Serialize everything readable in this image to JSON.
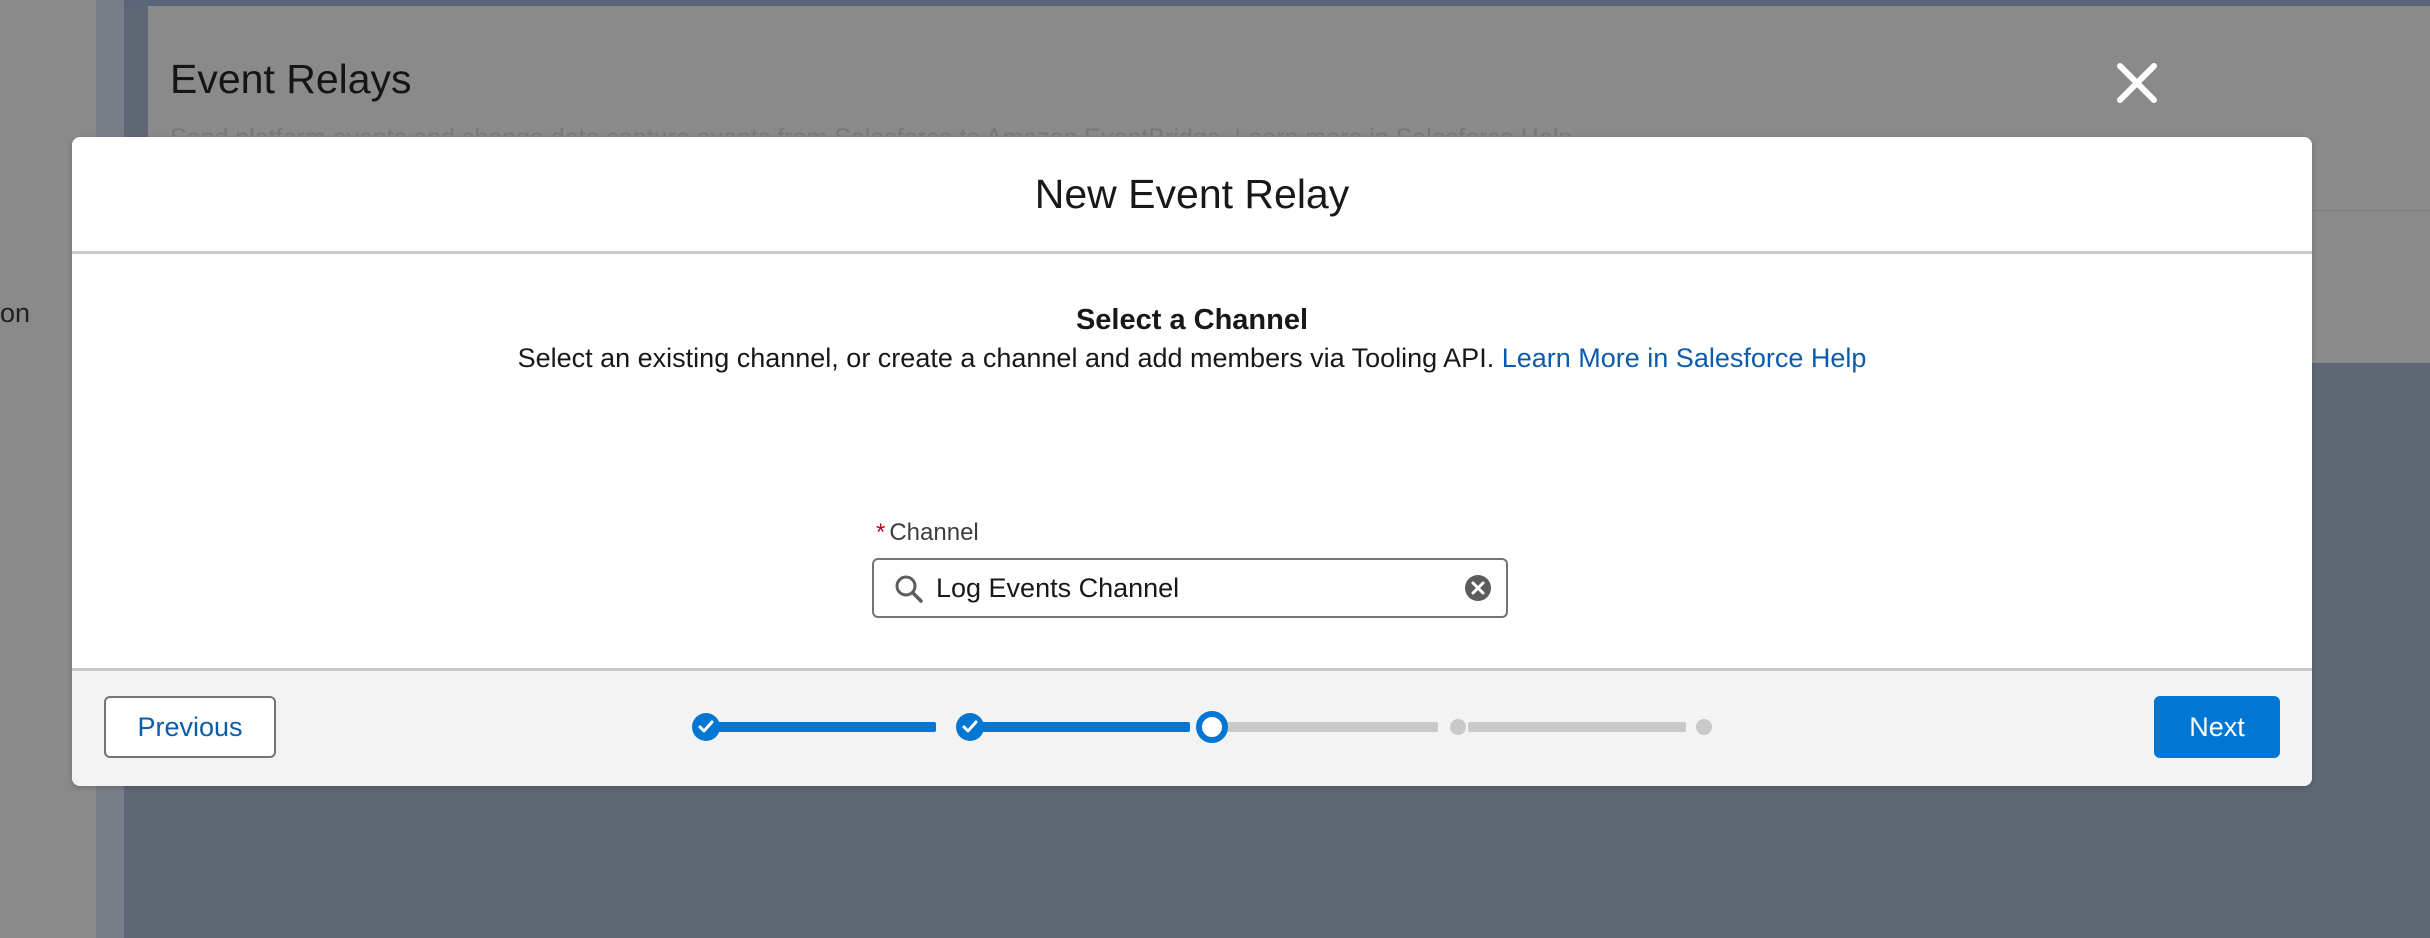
{
  "background": {
    "left_panel_text": "on",
    "page_title": "Event Relays",
    "page_subtitle": "Send platform events and change data capture events from Salesforce to Amazon EventBridge. Learn more in Salesforce Help."
  },
  "modal": {
    "title": "New Event Relay",
    "section_title": "Select a Channel",
    "description": "Select an existing channel, or create a channel and add members via Tooling API.",
    "help_link": "Learn More in Salesforce Help",
    "channel_field": {
      "required_marker": "*",
      "label": "Channel",
      "value": "Log Events Channel"
    },
    "footer": {
      "previous_label": "Previous",
      "next_label": "Next",
      "progress": {
        "total_steps": 5,
        "current_step": 3,
        "completed_steps": 2
      }
    }
  },
  "colors": {
    "brand": "#0176d3",
    "link": "#0b5cab",
    "required": "#ba0517",
    "overlay_bg": "#5f6775"
  },
  "icons": {
    "close": "close-icon",
    "search": "search-icon",
    "clear": "clear-icon",
    "check": "check-icon"
  }
}
